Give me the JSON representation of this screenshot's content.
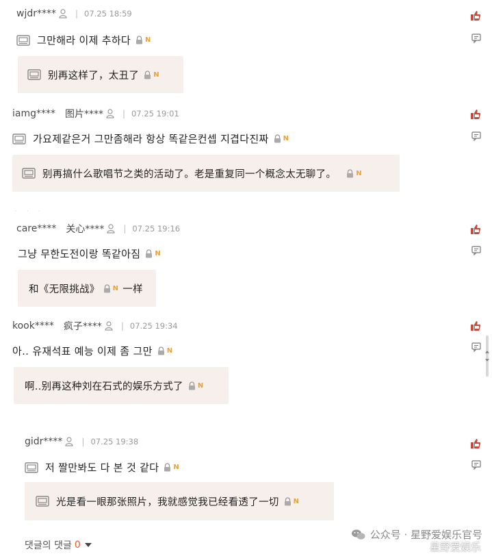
{
  "comments": [
    {
      "user": "wjdr****",
      "alias": "",
      "time": "07.25 18:59",
      "text": "그만해라 이제 추하다",
      "translation": "别再这样了，太丑了",
      "translation_after": ""
    },
    {
      "user": "iamg****",
      "alias": "图片****",
      "time": "07.25 19:01",
      "text": "가요제같은거 그만좀해라 항상 똑같은컨셉 지겹다진짜",
      "translation": "别再搞什么歌唱节之类的活动了。老是重复同一个概念太无聊了。",
      "translation_after": ""
    },
    {
      "user": "care****",
      "alias": "关心****",
      "time": "07.25 19:16",
      "text": "그냥 무한도전이랑 똑같아짐",
      "translation": "和《无限挑战》",
      "translation_after": "一样"
    },
    {
      "user": "kook****",
      "alias": "疯子****",
      "time": "07.25 19:34",
      "text": "아.. 유재석표 예능 이제 좀 그만",
      "translation": "啊..别再这种刘在石式的娱乐方式了",
      "translation_after": ""
    },
    {
      "user": "gidr****",
      "alias": "",
      "time": "07.25 19:38",
      "text": "저 짤만봐도 다 본 것 같다",
      "translation": "光是看一眼那张照片，我就感觉我已经看透了一切",
      "translation_after": ""
    }
  ],
  "badge_letter": "N",
  "footer": {
    "label": "댓글의 댓글",
    "count": "0"
  },
  "watermark": {
    "line1": "公众号 · 星野爱娱乐官号",
    "line2": "星野爱娱乐"
  },
  "colors": {
    "thumb_red": "#c94a3c",
    "translation_bg": "#f7efeb",
    "badge_orange": "#e8a238"
  },
  "icons": [
    "person-icon",
    "doc-icon",
    "lock-icon",
    "thumb-up-icon",
    "reply-icon",
    "wechat-icon",
    "caret-down-icon"
  ]
}
